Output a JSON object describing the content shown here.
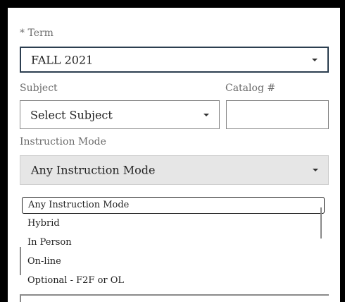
{
  "term": {
    "label": "* Term",
    "value": "FALL 2021"
  },
  "subject": {
    "label": "Subject",
    "value": "Select Subject"
  },
  "catalog": {
    "label": "Catalog #",
    "value": ""
  },
  "instruction_mode": {
    "label": "Instruction Mode",
    "value": "Any Instruction Mode",
    "options": [
      "Any Instruction Mode",
      "Hybrid",
      "In Person",
      "On-line",
      "Optional - F2F or OL"
    ],
    "selected_index": 0
  }
}
